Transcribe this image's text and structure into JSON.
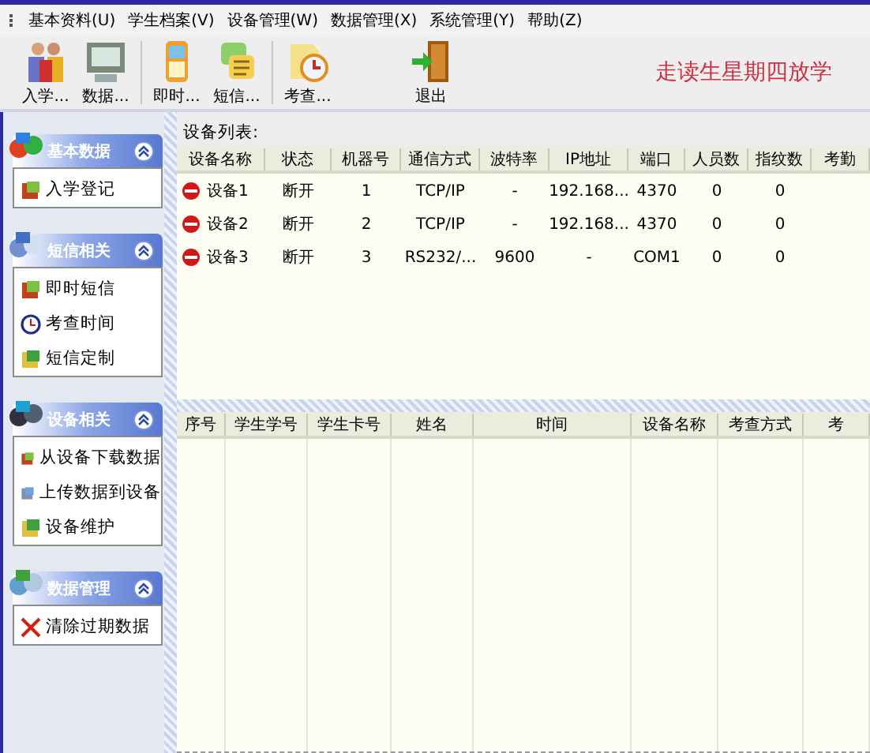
{
  "menu": [
    {
      "label": "基本资料(U)"
    },
    {
      "label": "学生档案(V)"
    },
    {
      "label": "设备管理(W)"
    },
    {
      "label": "数据管理(X)"
    },
    {
      "label": "系统管理(Y)"
    },
    {
      "label": "帮助(Z)"
    }
  ],
  "toolbar": [
    {
      "label": "入学...",
      "separator_after": false
    },
    {
      "label": "数据...",
      "separator_after": true
    },
    {
      "label": "即时...",
      "separator_after": false
    },
    {
      "label": "短信...",
      "separator_after": true
    },
    {
      "label": "考查...",
      "separator_after": false
    },
    {
      "label": "退出",
      "separator_after": false
    }
  ],
  "notice": "走读生星期四放学",
  "sidebar": [
    {
      "title": "基本数据",
      "expanded": true,
      "items": [
        "入学登记"
      ]
    },
    {
      "title": "短信相关",
      "expanded": true,
      "items": [
        "即时短信",
        "考查时间",
        "短信定制"
      ]
    },
    {
      "title": "设备相关",
      "expanded": true,
      "items": [
        "从设备下载数据",
        "上传数据到设备",
        "设备维护"
      ]
    },
    {
      "title": "数据管理",
      "expanded": true,
      "items": [
        "清除过期数据"
      ]
    }
  ],
  "device_list": {
    "title": "设备列表:",
    "columns": [
      "设备名称",
      "状态",
      "机器号",
      "通信方式",
      "波特率",
      "IP地址",
      "端口",
      "人员数",
      "指纹数",
      "考勤"
    ],
    "rows": [
      {
        "connected": false,
        "cells": [
          "设备1",
          "断开",
          "1",
          "TCP/IP",
          "-",
          "192.168...",
          "4370",
          "0",
          "0"
        ]
      },
      {
        "connected": false,
        "cells": [
          "设备2",
          "断开",
          "2",
          "TCP/IP",
          "-",
          "192.168...",
          "4370",
          "0",
          "0"
        ]
      },
      {
        "connected": false,
        "cells": [
          "设备3",
          "断开",
          "3",
          "RS232/...",
          "9600",
          "-",
          "COM1",
          "0",
          "0"
        ]
      }
    ]
  },
  "records": {
    "columns": [
      "序号",
      "学生学号",
      "学生卡号",
      "姓名",
      "时间",
      "设备名称",
      "考查方式",
      "考"
    ]
  }
}
